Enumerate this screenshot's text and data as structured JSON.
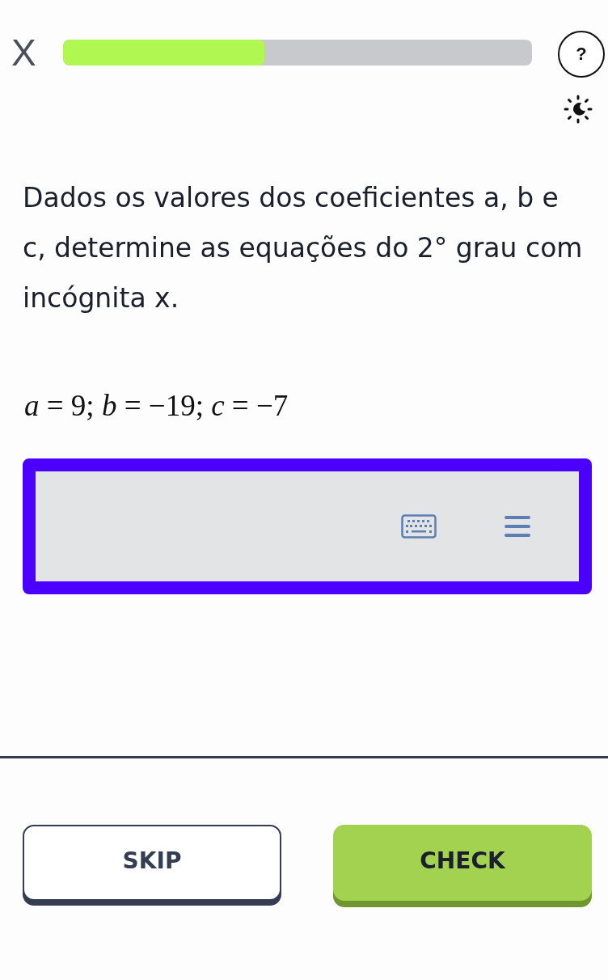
{
  "header": {
    "close": "X",
    "progress": {
      "level": 0.43
    },
    "help": "?"
  },
  "question": "Dados os valores dos coeficientes a, b e c, determine as equações do 2° grau com incógnita x.",
  "equation": "*a* = 9; *b* = −19; *c* = −7",
  "answer": {
    "focused": true
  },
  "buttons": [
    {
      "label": "SKIP",
      "kind": "secondary"
    },
    {
      "label": "CHECK",
      "kind": "primary"
    }
  ]
}
